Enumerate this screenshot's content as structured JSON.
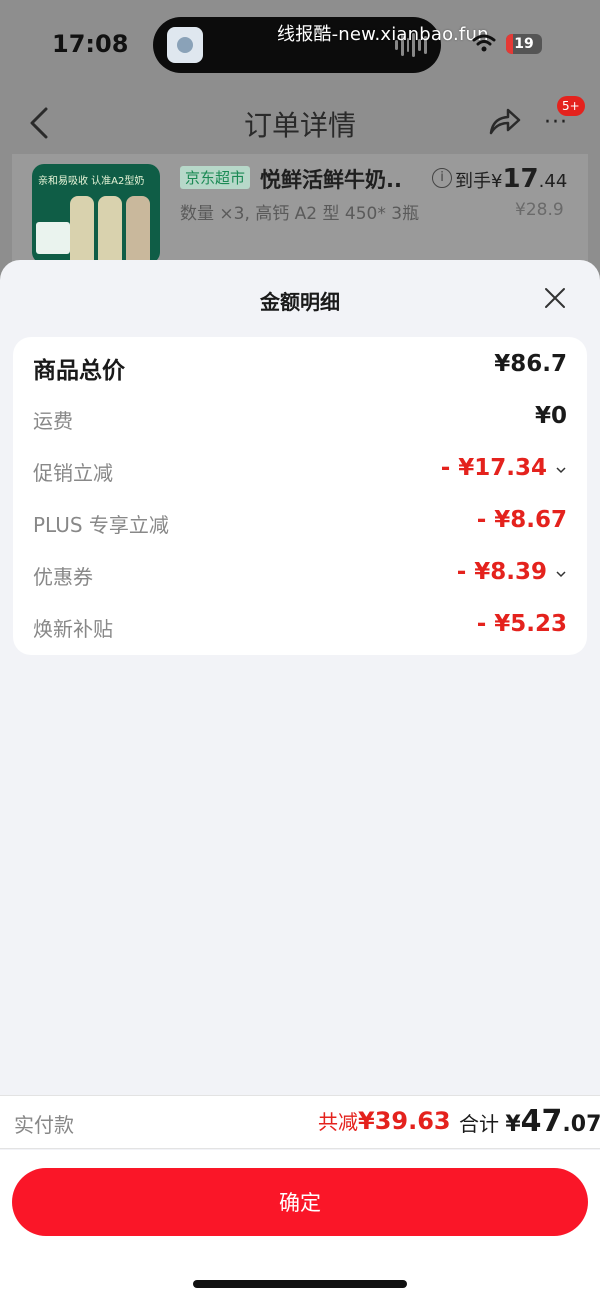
{
  "status_bar": {
    "time": "17:08",
    "watermark": "线报酷-new.xianbao.fun",
    "battery": "19",
    "battery_level": 0.19
  },
  "nav": {
    "title": "订单详情",
    "badge": "5+",
    "more": "···"
  },
  "product": {
    "tag": "京东超市",
    "name": "悦鲜活鲜牛奶..",
    "info_icon": "i",
    "to_hand_label": "到手",
    "yen": "¥",
    "price_int": "17",
    "price_dec": ".44",
    "original_price": "¥28.9",
    "spec": "数量 ×3, 高钙 A2 型 450* 3瓶",
    "image_banner": "亲和易吸收 认准A2型奶"
  },
  "sheet": {
    "title": "金额明细",
    "rows": [
      {
        "label": "商品总价",
        "value": "¥86.7"
      },
      {
        "label": "运费",
        "value": "¥0"
      },
      {
        "label": "促销立减",
        "value": "- ¥17.34"
      },
      {
        "label": "PLUS 专享立减",
        "value": "- ¥8.67"
      },
      {
        "label": "优惠券",
        "value": "- ¥8.39"
      },
      {
        "label": "焕新补贴",
        "value": "- ¥5.23"
      }
    ]
  },
  "total": {
    "paid_label": "实付款",
    "reduce_label": "共减",
    "reduce_value": "¥39.63",
    "sum_label": "合计",
    "sum_yen": "¥",
    "sum_int": "47",
    "sum_dec": ".07"
  },
  "confirm_label": "确定",
  "colors": {
    "accent_red": "#e4221d",
    "button_red": "#fa1628",
    "jd_green": "#1b8a55"
  }
}
